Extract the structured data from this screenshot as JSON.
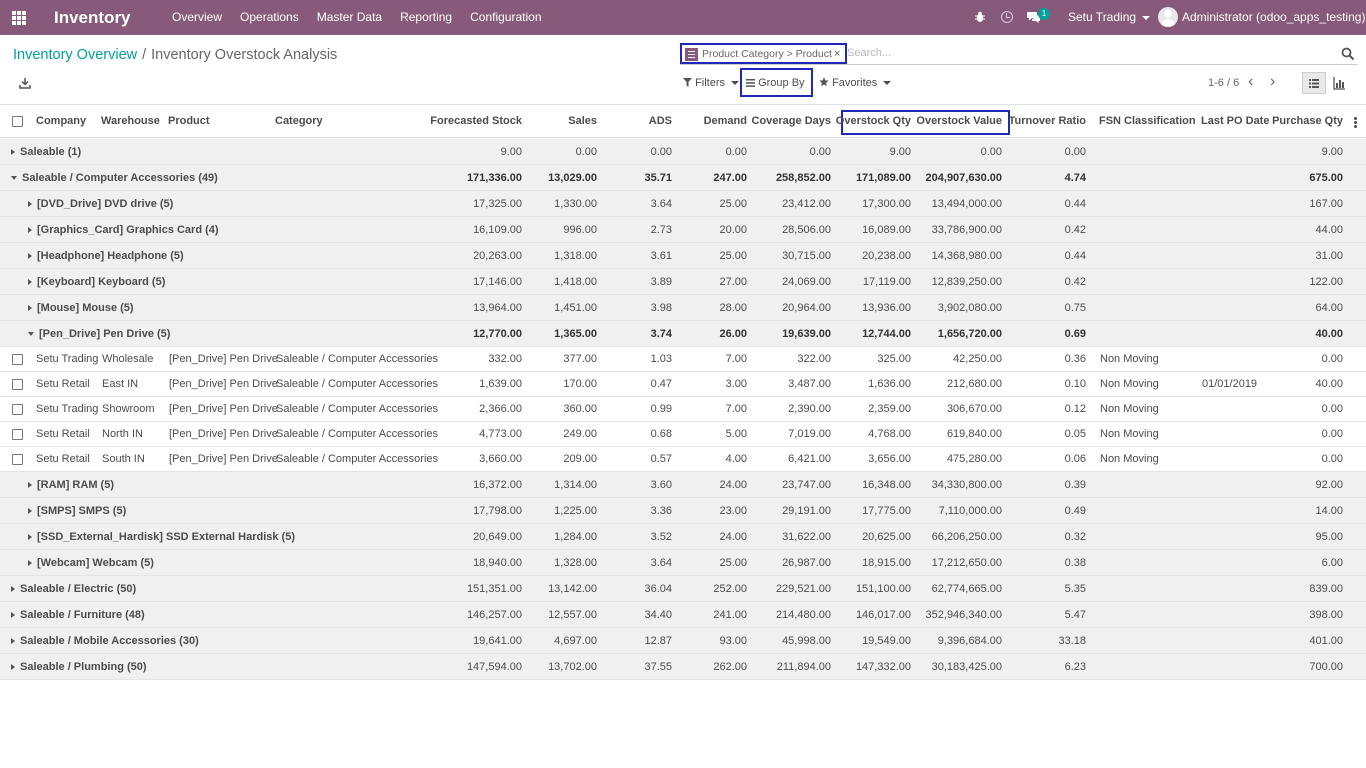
{
  "navbar": {
    "brand": "Inventory",
    "menu": [
      "Overview",
      "Operations",
      "Master Data",
      "Reporting",
      "Configuration"
    ],
    "chat_badge": "1",
    "company": "Setu Trading",
    "user": "Administrator (odoo_apps_testing)",
    "brand_color": "#875a7b"
  },
  "breadcrumb": {
    "parent": "Inventory Overview",
    "separator": "/",
    "current": "Inventory Overstock Analysis"
  },
  "search": {
    "facet_value": "Product Category > Product",
    "facet_remove": "×",
    "placeholder": "Search..."
  },
  "toolbar": {
    "filters": "Filters",
    "group_by": "Group By",
    "favorites": "Favorites",
    "pager": "1-6 / 6",
    "pager_prev": "‹",
    "pager_next": "›"
  },
  "columns": {
    "company": "Company",
    "warehouse": "Warehouse",
    "product": "Product",
    "category": "Category",
    "forecasted": "Forecasted Stock",
    "sales": "Sales",
    "ads": "ADS",
    "demand": "Demand",
    "coverage": "Coverage Days",
    "overstock_qty": "Overstock Qty",
    "overstock_value": "Overstock Value",
    "turnover": "Turnover Ratio",
    "fsn": "FSN Classification",
    "last_po": "Last PO Date",
    "purchase_qty": "Purchase Qty"
  },
  "rows": [
    {
      "type": "group",
      "level": 0,
      "open": false,
      "bold": false,
      "name": "Saleable (1)",
      "forecasted": "9.00",
      "sales": "0.00",
      "ads": "0.00",
      "demand": "0.00",
      "coverage": "0.00",
      "overstock_qty": "9.00",
      "overstock_value": "0.00",
      "turnover": "0.00",
      "purchase_qty": "9.00"
    },
    {
      "type": "group",
      "level": 0,
      "open": true,
      "bold": true,
      "name": "Saleable / Computer Accessories (49)",
      "forecasted": "171,336.00",
      "sales": "13,029.00",
      "ads": "35.71",
      "demand": "247.00",
      "coverage": "258,852.00",
      "overstock_qty": "171,089.00",
      "overstock_value": "204,907,630.00",
      "turnover": "4.74",
      "purchase_qty": "675.00"
    },
    {
      "type": "group",
      "level": 1,
      "open": false,
      "bold": false,
      "name": "[DVD_Drive] DVD drive (5)",
      "forecasted": "17,325.00",
      "sales": "1,330.00",
      "ads": "3.64",
      "demand": "25.00",
      "coverage": "23,412.00",
      "overstock_qty": "17,300.00",
      "overstock_value": "13,494,000.00",
      "turnover": "0.44",
      "purchase_qty": "167.00"
    },
    {
      "type": "group",
      "level": 1,
      "open": false,
      "bold": false,
      "name": "[Graphics_Card] Graphics Card (4)",
      "forecasted": "16,109.00",
      "sales": "996.00",
      "ads": "2.73",
      "demand": "20.00",
      "coverage": "28,506.00",
      "overstock_qty": "16,089.00",
      "overstock_value": "33,786,900.00",
      "turnover": "0.42",
      "purchase_qty": "44.00"
    },
    {
      "type": "group",
      "level": 1,
      "open": false,
      "bold": false,
      "name": "[Headphone] Headphone (5)",
      "forecasted": "20,263.00",
      "sales": "1,318.00",
      "ads": "3.61",
      "demand": "25.00",
      "coverage": "30,715.00",
      "overstock_qty": "20,238.00",
      "overstock_value": "14,368,980.00",
      "turnover": "0.44",
      "purchase_qty": "31.00"
    },
    {
      "type": "group",
      "level": 1,
      "open": false,
      "bold": false,
      "name": "[Keyboard] Keyboard (5)",
      "forecasted": "17,146.00",
      "sales": "1,418.00",
      "ads": "3.89",
      "demand": "27.00",
      "coverage": "24,069.00",
      "overstock_qty": "17,119.00",
      "overstock_value": "12,839,250.00",
      "turnover": "0.42",
      "purchase_qty": "122.00"
    },
    {
      "type": "group",
      "level": 1,
      "open": false,
      "bold": false,
      "name": "[Mouse] Mouse (5)",
      "forecasted": "13,964.00",
      "sales": "1,451.00",
      "ads": "3.98",
      "demand": "28.00",
      "coverage": "20,964.00",
      "overstock_qty": "13,936.00",
      "overstock_value": "3,902,080.00",
      "turnover": "0.75",
      "purchase_qty": "64.00"
    },
    {
      "type": "group",
      "level": 1,
      "open": true,
      "bold": true,
      "name": "[Pen_Drive] Pen Drive (5)",
      "forecasted": "12,770.00",
      "sales": "1,365.00",
      "ads": "3.74",
      "demand": "26.00",
      "coverage": "19,639.00",
      "overstock_qty": "12,744.00",
      "overstock_value": "1,656,720.00",
      "turnover": "0.69",
      "purchase_qty": "40.00"
    },
    {
      "type": "rec",
      "company": "Setu Trading",
      "warehouse": "Wholesale",
      "product": "[Pen_Drive] Pen Drive",
      "category": "Saleable / Computer Accessories",
      "forecasted": "332.00",
      "sales": "377.00",
      "ads": "1.03",
      "demand": "7.00",
      "coverage": "322.00",
      "overstock_qty": "325.00",
      "overstock_value": "42,250.00",
      "turnover": "0.36",
      "fsn": "Non Moving",
      "last_po": "",
      "purchase_qty": "0.00"
    },
    {
      "type": "rec",
      "company": "Setu Retail",
      "warehouse": "East IN",
      "product": "[Pen_Drive] Pen Drive",
      "category": "Saleable / Computer Accessories",
      "forecasted": "1,639.00",
      "sales": "170.00",
      "ads": "0.47",
      "demand": "3.00",
      "coverage": "3,487.00",
      "overstock_qty": "1,636.00",
      "overstock_value": "212,680.00",
      "turnover": "0.10",
      "fsn": "Non Moving",
      "last_po": "01/01/2019",
      "purchase_qty": "40.00"
    },
    {
      "type": "rec",
      "company": "Setu Trading",
      "warehouse": "Showroom",
      "product": "[Pen_Drive] Pen Drive",
      "category": "Saleable / Computer Accessories",
      "forecasted": "2,366.00",
      "sales": "360.00",
      "ads": "0.99",
      "demand": "7.00",
      "coverage": "2,390.00",
      "overstock_qty": "2,359.00",
      "overstock_value": "306,670.00",
      "turnover": "0.12",
      "fsn": "Non Moving",
      "last_po": "",
      "purchase_qty": "0.00"
    },
    {
      "type": "rec",
      "company": "Setu Retail",
      "warehouse": "North IN",
      "product": "[Pen_Drive] Pen Drive",
      "category": "Saleable / Computer Accessories",
      "forecasted": "4,773.00",
      "sales": "249.00",
      "ads": "0.68",
      "demand": "5.00",
      "coverage": "7,019.00",
      "overstock_qty": "4,768.00",
      "overstock_value": "619,840.00",
      "turnover": "0.05",
      "fsn": "Non Moving",
      "last_po": "",
      "purchase_qty": "0.00"
    },
    {
      "type": "rec",
      "company": "Setu Retail",
      "warehouse": "South IN",
      "product": "[Pen_Drive] Pen Drive",
      "category": "Saleable / Computer Accessories",
      "forecasted": "3,660.00",
      "sales": "209.00",
      "ads": "0.57",
      "demand": "4.00",
      "coverage": "6,421.00",
      "overstock_qty": "3,656.00",
      "overstock_value": "475,280.00",
      "turnover": "0.06",
      "fsn": "Non Moving",
      "last_po": "",
      "purchase_qty": "0.00"
    },
    {
      "type": "group",
      "level": 1,
      "open": false,
      "bold": false,
      "name": "[RAM] RAM (5)",
      "forecasted": "16,372.00",
      "sales": "1,314.00",
      "ads": "3.60",
      "demand": "24.00",
      "coverage": "23,747.00",
      "overstock_qty": "16,348.00",
      "overstock_value": "34,330,800.00",
      "turnover": "0.39",
      "purchase_qty": "92.00"
    },
    {
      "type": "group",
      "level": 1,
      "open": false,
      "bold": false,
      "name": "[SMPS] SMPS (5)",
      "forecasted": "17,798.00",
      "sales": "1,225.00",
      "ads": "3.36",
      "demand": "23.00",
      "coverage": "29,191.00",
      "overstock_qty": "17,775.00",
      "overstock_value": "7,110,000.00",
      "turnover": "0.49",
      "purchase_qty": "14.00"
    },
    {
      "type": "group",
      "level": 1,
      "open": false,
      "bold": false,
      "name": "[SSD_External_Hardisk] SSD External Hardisk (5)",
      "forecasted": "20,649.00",
      "sales": "1,284.00",
      "ads": "3.52",
      "demand": "24.00",
      "coverage": "31,622.00",
      "overstock_qty": "20,625.00",
      "overstock_value": "66,206,250.00",
      "turnover": "0.32",
      "purchase_qty": "95.00"
    },
    {
      "type": "group",
      "level": 1,
      "open": false,
      "bold": false,
      "name": "[Webcam] Webcam (5)",
      "forecasted": "18,940.00",
      "sales": "1,328.00",
      "ads": "3.64",
      "demand": "25.00",
      "coverage": "26,987.00",
      "overstock_qty": "18,915.00",
      "overstock_value": "17,212,650.00",
      "turnover": "0.38",
      "purchase_qty": "6.00"
    },
    {
      "type": "group",
      "level": 0,
      "open": false,
      "bold": false,
      "name": "Saleable / Electric (50)",
      "forecasted": "151,351.00",
      "sales": "13,142.00",
      "ads": "36.04",
      "demand": "252.00",
      "coverage": "229,521.00",
      "overstock_qty": "151,100.00",
      "overstock_value": "62,774,665.00",
      "turnover": "5.35",
      "purchase_qty": "839.00"
    },
    {
      "type": "group",
      "level": 0,
      "open": false,
      "bold": false,
      "name": "Saleable / Furniture (48)",
      "forecasted": "146,257.00",
      "sales": "12,557.00",
      "ads": "34.40",
      "demand": "241.00",
      "coverage": "214,480.00",
      "overstock_qty": "146,017.00",
      "overstock_value": "352,946,340.00",
      "turnover": "5.47",
      "purchase_qty": "398.00"
    },
    {
      "type": "group",
      "level": 0,
      "open": false,
      "bold": false,
      "name": "Saleable / Mobile Accessories (30)",
      "forecasted": "19,641.00",
      "sales": "4,697.00",
      "ads": "12.87",
      "demand": "93.00",
      "coverage": "45,998.00",
      "overstock_qty": "19,549.00",
      "overstock_value": "9,396,684.00",
      "turnover": "33.18",
      "purchase_qty": "401.00"
    },
    {
      "type": "group",
      "level": 0,
      "open": false,
      "bold": false,
      "name": "Saleable / Plumbing (50)",
      "forecasted": "147,594.00",
      "sales": "13,702.00",
      "ads": "37.55",
      "demand": "262.00",
      "coverage": "211,894.00",
      "overstock_qty": "147,332.00",
      "overstock_value": "30,183,425.00",
      "turnover": "6.23",
      "purchase_qty": "700.00"
    }
  ]
}
